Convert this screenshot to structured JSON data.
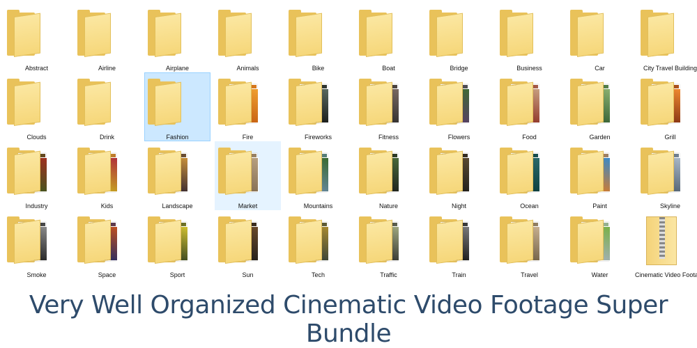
{
  "folders": [
    {
      "name": "Abstract",
      "style": "plain"
    },
    {
      "name": "Airline",
      "style": "plain"
    },
    {
      "name": "Airplane",
      "style": "plain"
    },
    {
      "name": "Animals",
      "style": "plain"
    },
    {
      "name": "Bike",
      "style": "plain"
    },
    {
      "name": "Boat",
      "style": "plain"
    },
    {
      "name": "Bridge",
      "style": "plain"
    },
    {
      "name": "Business",
      "style": "plain"
    },
    {
      "name": "Car",
      "style": "plain"
    },
    {
      "name": "City Travel Building",
      "style": "plain"
    },
    {
      "name": "Clouds",
      "style": "plain"
    },
    {
      "name": "Drink",
      "style": "plain"
    },
    {
      "name": "Fashion",
      "style": "plain",
      "state": "selected"
    },
    {
      "name": "Fire",
      "style": "thumb",
      "colors": [
        "#c25a10",
        "#f0a030"
      ]
    },
    {
      "name": "Fireworks",
      "style": "thumb",
      "colors": [
        "#111111",
        "#5a6a60"
      ]
    },
    {
      "name": "Fitness",
      "style": "thumb",
      "colors": [
        "#2a2a2a",
        "#7a6a62"
      ]
    },
    {
      "name": "Flowers",
      "style": "thumb",
      "colors": [
        "#5a3a6a",
        "#3f6a35"
      ]
    },
    {
      "name": "Food",
      "style": "thumb",
      "colors": [
        "#8a2a20",
        "#c8a080"
      ]
    },
    {
      "name": "Garden",
      "style": "thumb",
      "colors": [
        "#2f5a30",
        "#8ab070"
      ]
    },
    {
      "name": "Grill",
      "style": "thumb",
      "colors": [
        "#7a2a10",
        "#f08a30"
      ]
    },
    {
      "name": "Industry",
      "style": "thumb",
      "colors": [
        "#3a5a20",
        "#a03020"
      ]
    },
    {
      "name": "Kids",
      "style": "thumb",
      "colors": [
        "#c8b020",
        "#b0303a"
      ]
    },
    {
      "name": "Landscape",
      "style": "thumb",
      "colors": [
        "#2a2030",
        "#c8903a"
      ]
    },
    {
      "name": "Market",
      "style": "thumb",
      "colors": [
        "#806a50",
        "#b8a080"
      ],
      "state": "hover"
    },
    {
      "name": "Mountains",
      "style": "thumb",
      "colors": [
        "#6a8aa8",
        "#3a6a30"
      ]
    },
    {
      "name": "Nature",
      "style": "thumb",
      "colors": [
        "#1a1a1a",
        "#4a6a3a"
      ]
    },
    {
      "name": "Night",
      "style": "thumb",
      "colors": [
        "#1a1a1a",
        "#5a4a30"
      ]
    },
    {
      "name": "Ocean",
      "style": "thumb",
      "colors": [
        "#0a3a3a",
        "#2a6a6a"
      ]
    },
    {
      "name": "Paint",
      "style": "thumb",
      "colors": [
        "#e07a20",
        "#3a8ac8"
      ]
    },
    {
      "name": "Skyline",
      "style": "thumb",
      "colors": [
        "#4a5a6a",
        "#a8b8c8"
      ]
    },
    {
      "name": "Smoke",
      "style": "thumb",
      "colors": [
        "#1a1a1a",
        "#8a8a8a"
      ]
    },
    {
      "name": "Space",
      "style": "thumb",
      "colors": [
        "#1a2a6a",
        "#c05020"
      ]
    },
    {
      "name": "Sport",
      "style": "thumb",
      "colors": [
        "#2a3a20",
        "#d0c030"
      ]
    },
    {
      "name": "Sun",
      "style": "thumb",
      "colors": [
        "#1a1a1a",
        "#6a4a2a"
      ]
    },
    {
      "name": "Tech",
      "style": "thumb",
      "colors": [
        "#2a3a3a",
        "#a88a30"
      ]
    },
    {
      "name": "Traffic",
      "style": "thumb",
      "colors": [
        "#2a2a2a",
        "#a0a880"
      ]
    },
    {
      "name": "Train",
      "style": "thumb",
      "colors": [
        "#101010",
        "#7a7a7a"
      ]
    },
    {
      "name": "Travel",
      "style": "thumb",
      "colors": [
        "#6a5a40",
        "#c8b090"
      ]
    },
    {
      "name": "Water",
      "style": "thumb",
      "colors": [
        "#a8b0c0",
        "#78b048"
      ]
    },
    {
      "name": "Cinematic Video Footage",
      "style": "zip"
    }
  ],
  "caption": "Very Well Organized Cinematic Video Footage Super Bundle"
}
